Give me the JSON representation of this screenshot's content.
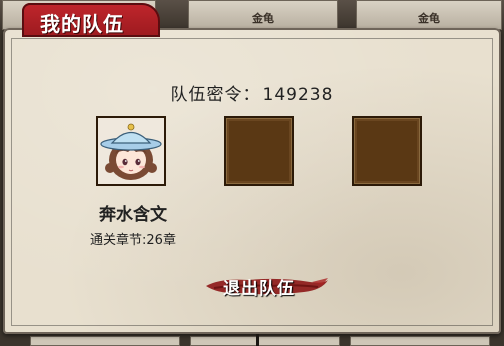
{
  "background": {
    "cards": [
      {
        "label": ""
      },
      {
        "label": "金龟"
      },
      {
        "label": "金龟"
      }
    ]
  },
  "panel": {
    "title": "我的队伍",
    "team_code_label": "队伍密令：",
    "team_code_value": "149238",
    "slots": [
      {
        "filled": true,
        "icon": "chibi-girl-avatar"
      },
      {
        "filled": false
      },
      {
        "filled": false
      }
    ],
    "member": {
      "name": "奔水含文",
      "progress": "通关章节:26章"
    },
    "quit_button": "退出队伍"
  },
  "colors": {
    "title_tab": "#b0202a",
    "slot_fill": "#5a3814",
    "parchment": "#e8e0cf"
  }
}
